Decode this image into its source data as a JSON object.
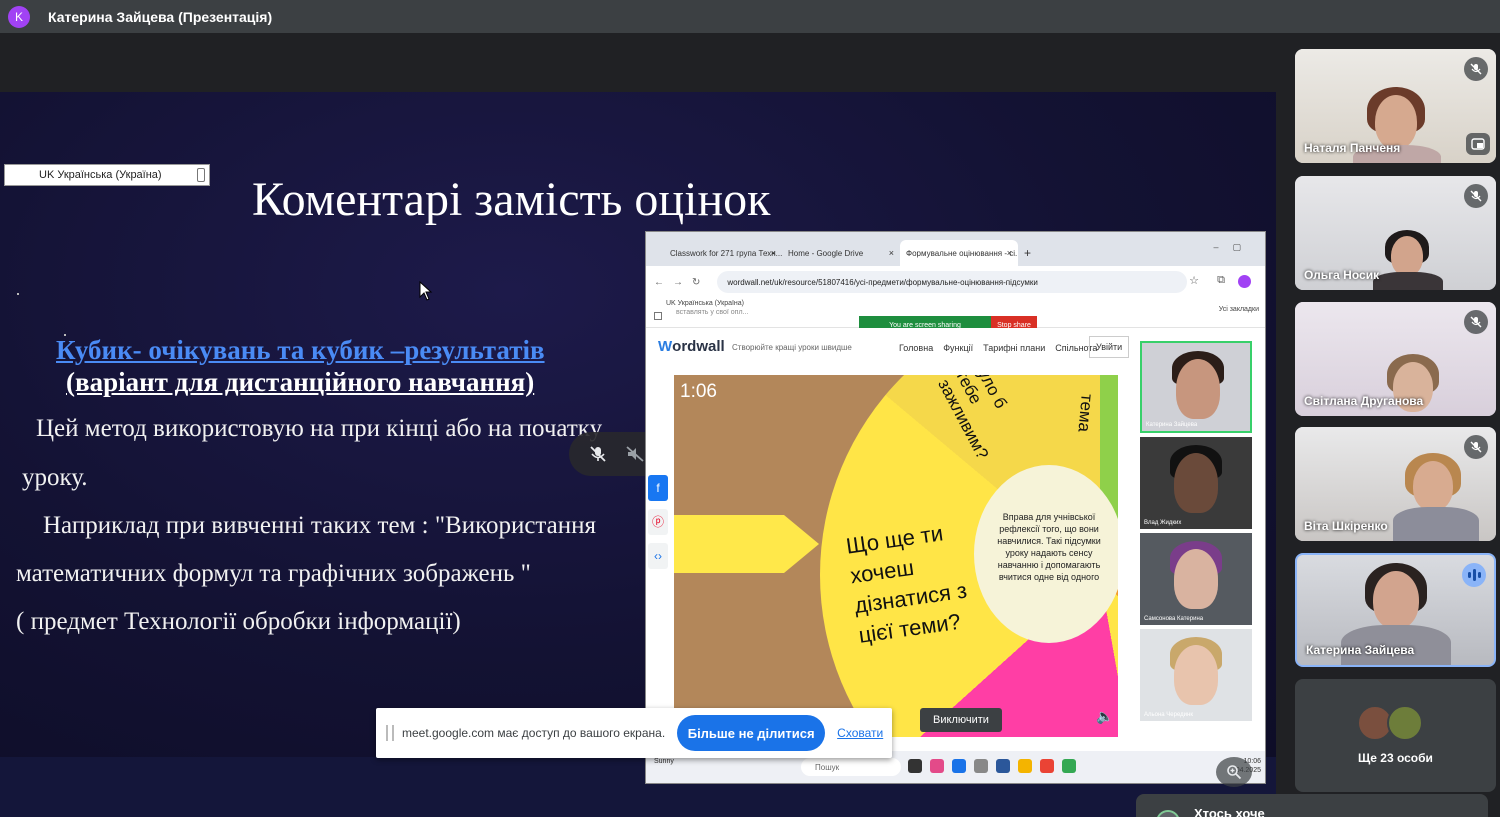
{
  "topbar": {
    "avatar_letter": "K",
    "title": "Катерина Зайцева (Презентація)"
  },
  "slide": {
    "lang_indicator": "UK Українська (Україна)",
    "title": "Коментарі замість оцінок",
    "link_text": "Кубик- очікувань та кубик –результатів",
    "subtitle": "(варіант для дистанційного навчання)",
    "body_lines": [
      "Цей метод використовую на при кінці або на початку",
      "уроку.",
      "Наприклад при вивченні таких тем : \"Використання",
      "математичних формул та графічних зображень \"",
      "( предмет Технології обробки інформації)"
    ]
  },
  "shared_screen": {
    "tabs": [
      "Classwork for 271 група Техн...",
      "Home - Google Drive",
      "Формувальне оцінювання - сі..."
    ],
    "url": "wordwall.net/uk/resource/51807416/усі-предмети/формувальне-оцінювання-підсумки",
    "bookmark_lang": "UK Українська (Україна)",
    "bookmark_sub": "вставлять у свої опл...",
    "all_bookmarks": "Усі закладки",
    "sharing_label": "You are screen sharing",
    "stop_share_label": "Stop share",
    "ww_logo_a": "W",
    "ww_logo_b": "ordwall",
    "ww_tagline": "Створюйте кращі уроки швидше",
    "ww_links": [
      "Головна",
      "Функції",
      "Тарифні плани",
      "Спільнота"
    ],
    "ww_login": "Увійти",
    "timer": "1:06",
    "wheel_question": "Що ще ти хочеш дізнатися з цієї теми?",
    "wheel_top_text": "було б тебе зажливим?",
    "wheel_right_text": "тема",
    "wheel_center_text": "Вправа для учнівської рефлексії того, що вони навчилися. Такі підсумки уроку надають сенсу навчанню і допомагають вчитися одне від одного",
    "enable_button": "Виключити",
    "inner_participants": [
      "Катерина Зайцева",
      "Влад Жидких",
      "Самсонова Катерина",
      "Альона Черединк"
    ],
    "taskbar_search": "Пошук",
    "taskbar_weather": "Sunny",
    "taskbar_time": "10:06",
    "taskbar_date": "04.2025"
  },
  "toast": {
    "message": "meet.google.com має доступ до вашого екрана.",
    "stop_button": "Більше не ділитися",
    "hide_link": "Сховати"
  },
  "participants": [
    {
      "name": "Наталя Панченя",
      "muted": true
    },
    {
      "name": "Ольга Носик",
      "muted": true
    },
    {
      "name": "Світлана Друганова",
      "muted": true
    },
    {
      "name": "Віта Шкіренко",
      "muted": true
    },
    {
      "name": "Катерина Зайцева",
      "muted": false,
      "speaking": true
    }
  ],
  "more_participants": "Ще 23 особи",
  "knock_text": "Хтось хоче",
  "colors": {
    "accent": "#1a73e8",
    "speaking": "#8ab4f8",
    "topbar": "#3c4043",
    "slide_link": "#4a8bf5"
  }
}
